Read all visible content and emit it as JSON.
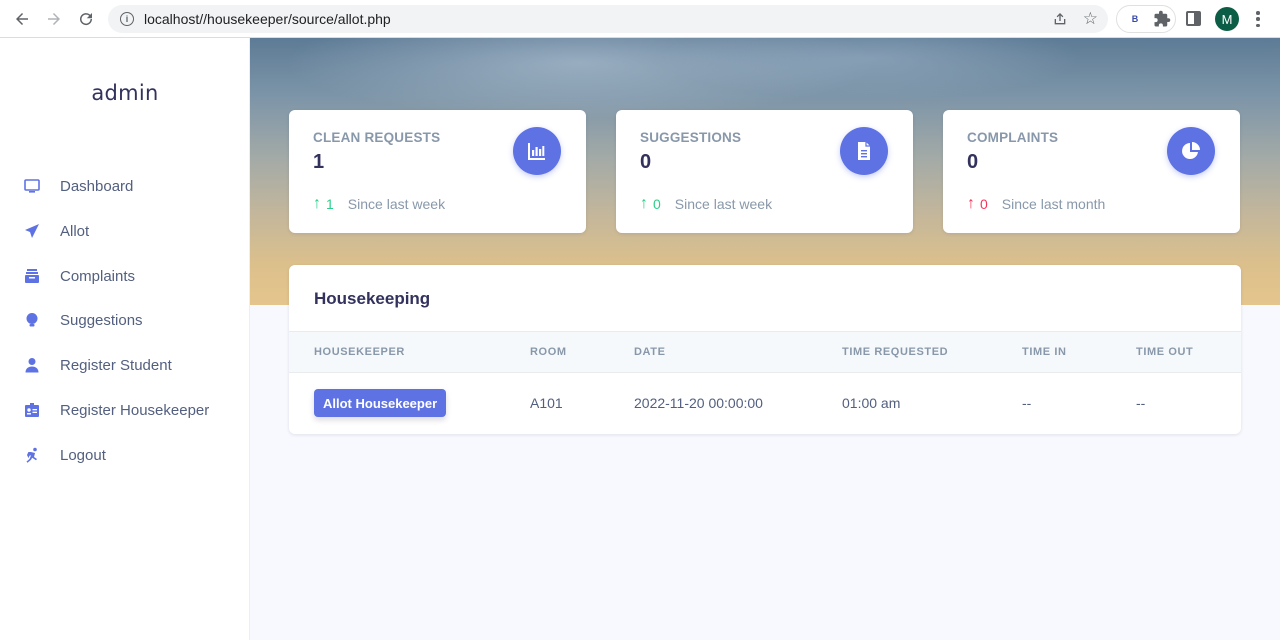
{
  "browser": {
    "url": "localhost//housekeeper/source/allot.php",
    "extension_label": "B",
    "avatar_initial": "M"
  },
  "sidebar": {
    "brand": "admin",
    "items": [
      {
        "label": "Dashboard",
        "icon": "monitor-icon"
      },
      {
        "label": "Allot",
        "icon": "send-icon"
      },
      {
        "label": "Complaints",
        "icon": "archive-icon"
      },
      {
        "label": "Suggestions",
        "icon": "bulb-icon"
      },
      {
        "label": "Register Student",
        "icon": "user-icon"
      },
      {
        "label": "Register Housekeeper",
        "icon": "id-card-icon"
      },
      {
        "label": "Logout",
        "icon": "running-icon"
      }
    ]
  },
  "stats": [
    {
      "title": "CLEAN REQUESTS",
      "value": "1",
      "delta": "1",
      "since": "Since last week",
      "direction": "up",
      "icon": "bar-chart-icon"
    },
    {
      "title": "SUGGESTIONS",
      "value": "0",
      "delta": "0",
      "since": "Since last week",
      "direction": "up",
      "icon": "document-icon"
    },
    {
      "title": "COMPLAINTS",
      "value": "0",
      "delta": "0",
      "since": "Since last month",
      "direction": "down",
      "icon": "pie-chart-icon"
    }
  ],
  "table": {
    "title": "Housekeeping",
    "columns": [
      "HOUSEKEEPER",
      "ROOM",
      "DATE",
      "TIME REQUESTED",
      "TIME IN",
      "TIME OUT"
    ],
    "rows": [
      {
        "action": "Allot Housekeeper",
        "room": "A101",
        "date": "2022-11-20 00:00:00",
        "time_requested": "01:00 am",
        "time_in": "--",
        "time_out": "--"
      }
    ]
  },
  "colors": {
    "accent": "#5e72e4",
    "up": "#2dce89",
    "down": "#f5365c"
  }
}
